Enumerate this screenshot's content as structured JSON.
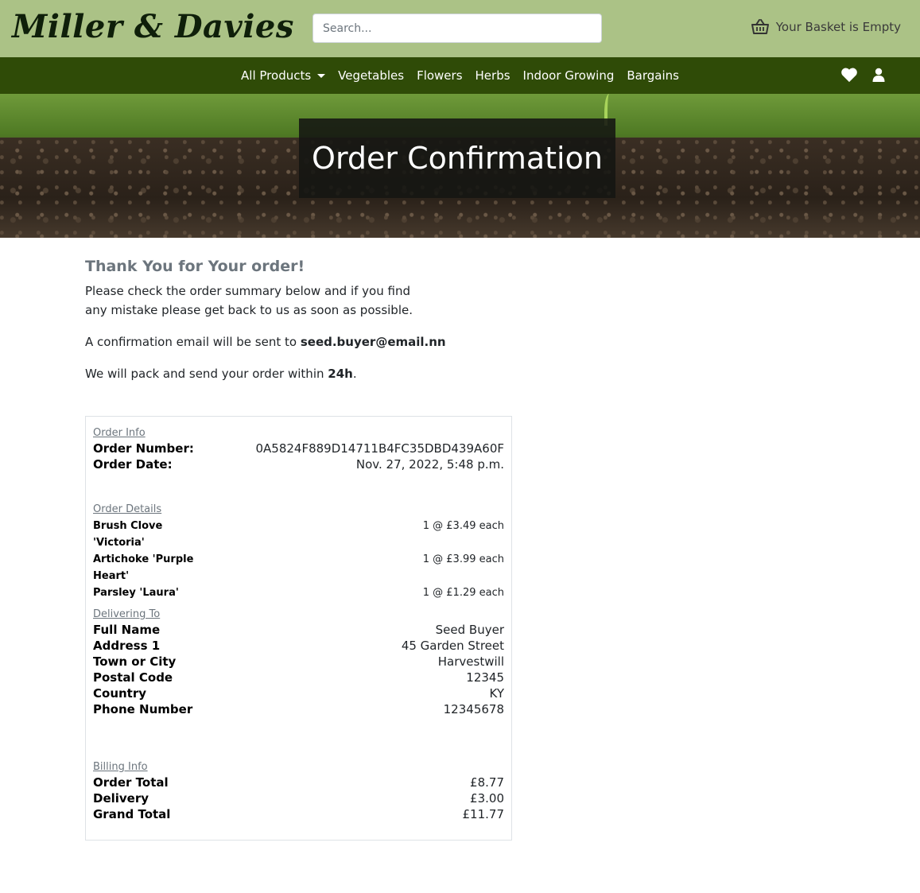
{
  "header": {
    "logo": "Miller & Davies",
    "search_placeholder": "Search...",
    "basket_label": "Your Basket is Empty"
  },
  "nav": {
    "items": [
      {
        "label": "All Products",
        "dropdown": true
      },
      {
        "label": "Vegetables"
      },
      {
        "label": "Flowers"
      },
      {
        "label": "Herbs"
      },
      {
        "label": "Indoor Growing"
      },
      {
        "label": "Bargains"
      }
    ],
    "icons": [
      "heart-icon",
      "user-icon"
    ]
  },
  "hero": {
    "title": "Order Confirmation"
  },
  "message": {
    "heading": "Thank You for Your order!",
    "line1": "Please check the order summary below and if you find any mistake please get back to us as soon as possible.",
    "email_prefix": "A confirmation email will be sent to ",
    "email": "seed.buyer@email.nn",
    "pack_prefix": "We will pack and send your order within ",
    "pack_time": "24h",
    "pack_suffix": "."
  },
  "order_info": {
    "title": "Order Info",
    "number_label": "Order Number:",
    "number": "0A5824F889D14711B4FC35DBD439A60F",
    "date_label": "Order Date:",
    "date": "Nov. 27, 2022, 5:48 p.m."
  },
  "order_details": {
    "title": "Order Details",
    "items": [
      {
        "name": "Brush Clove 'Victoria'",
        "qty": "1 @ £3.49 each"
      },
      {
        "name": "Artichoke 'Purple Heart'",
        "qty": "1 @ £3.99 each"
      },
      {
        "name": "Parsley 'Laura'",
        "qty": "1 @ £1.29 each"
      }
    ]
  },
  "delivery": {
    "title": "Delivering To",
    "rows": [
      {
        "label": "Full Name",
        "value": "Seed Buyer"
      },
      {
        "label": "Address 1",
        "value": "45 Garden Street"
      },
      {
        "label": "Town or City",
        "value": "Harvestwill"
      },
      {
        "label": "Postal Code",
        "value": "12345"
      },
      {
        "label": "Country",
        "value": "KY"
      },
      {
        "label": "Phone Number",
        "value": "12345678"
      }
    ]
  },
  "billing": {
    "title": "Billing Info",
    "rows": [
      {
        "label": "Order Total",
        "value": "£8.77"
      },
      {
        "label": "Delivery",
        "value": "£3.00"
      },
      {
        "label": "Grand Total",
        "value": "£11.77"
      }
    ]
  },
  "colors": {
    "header_bg": "#abc286",
    "nav_bg": "#2f4b07"
  }
}
